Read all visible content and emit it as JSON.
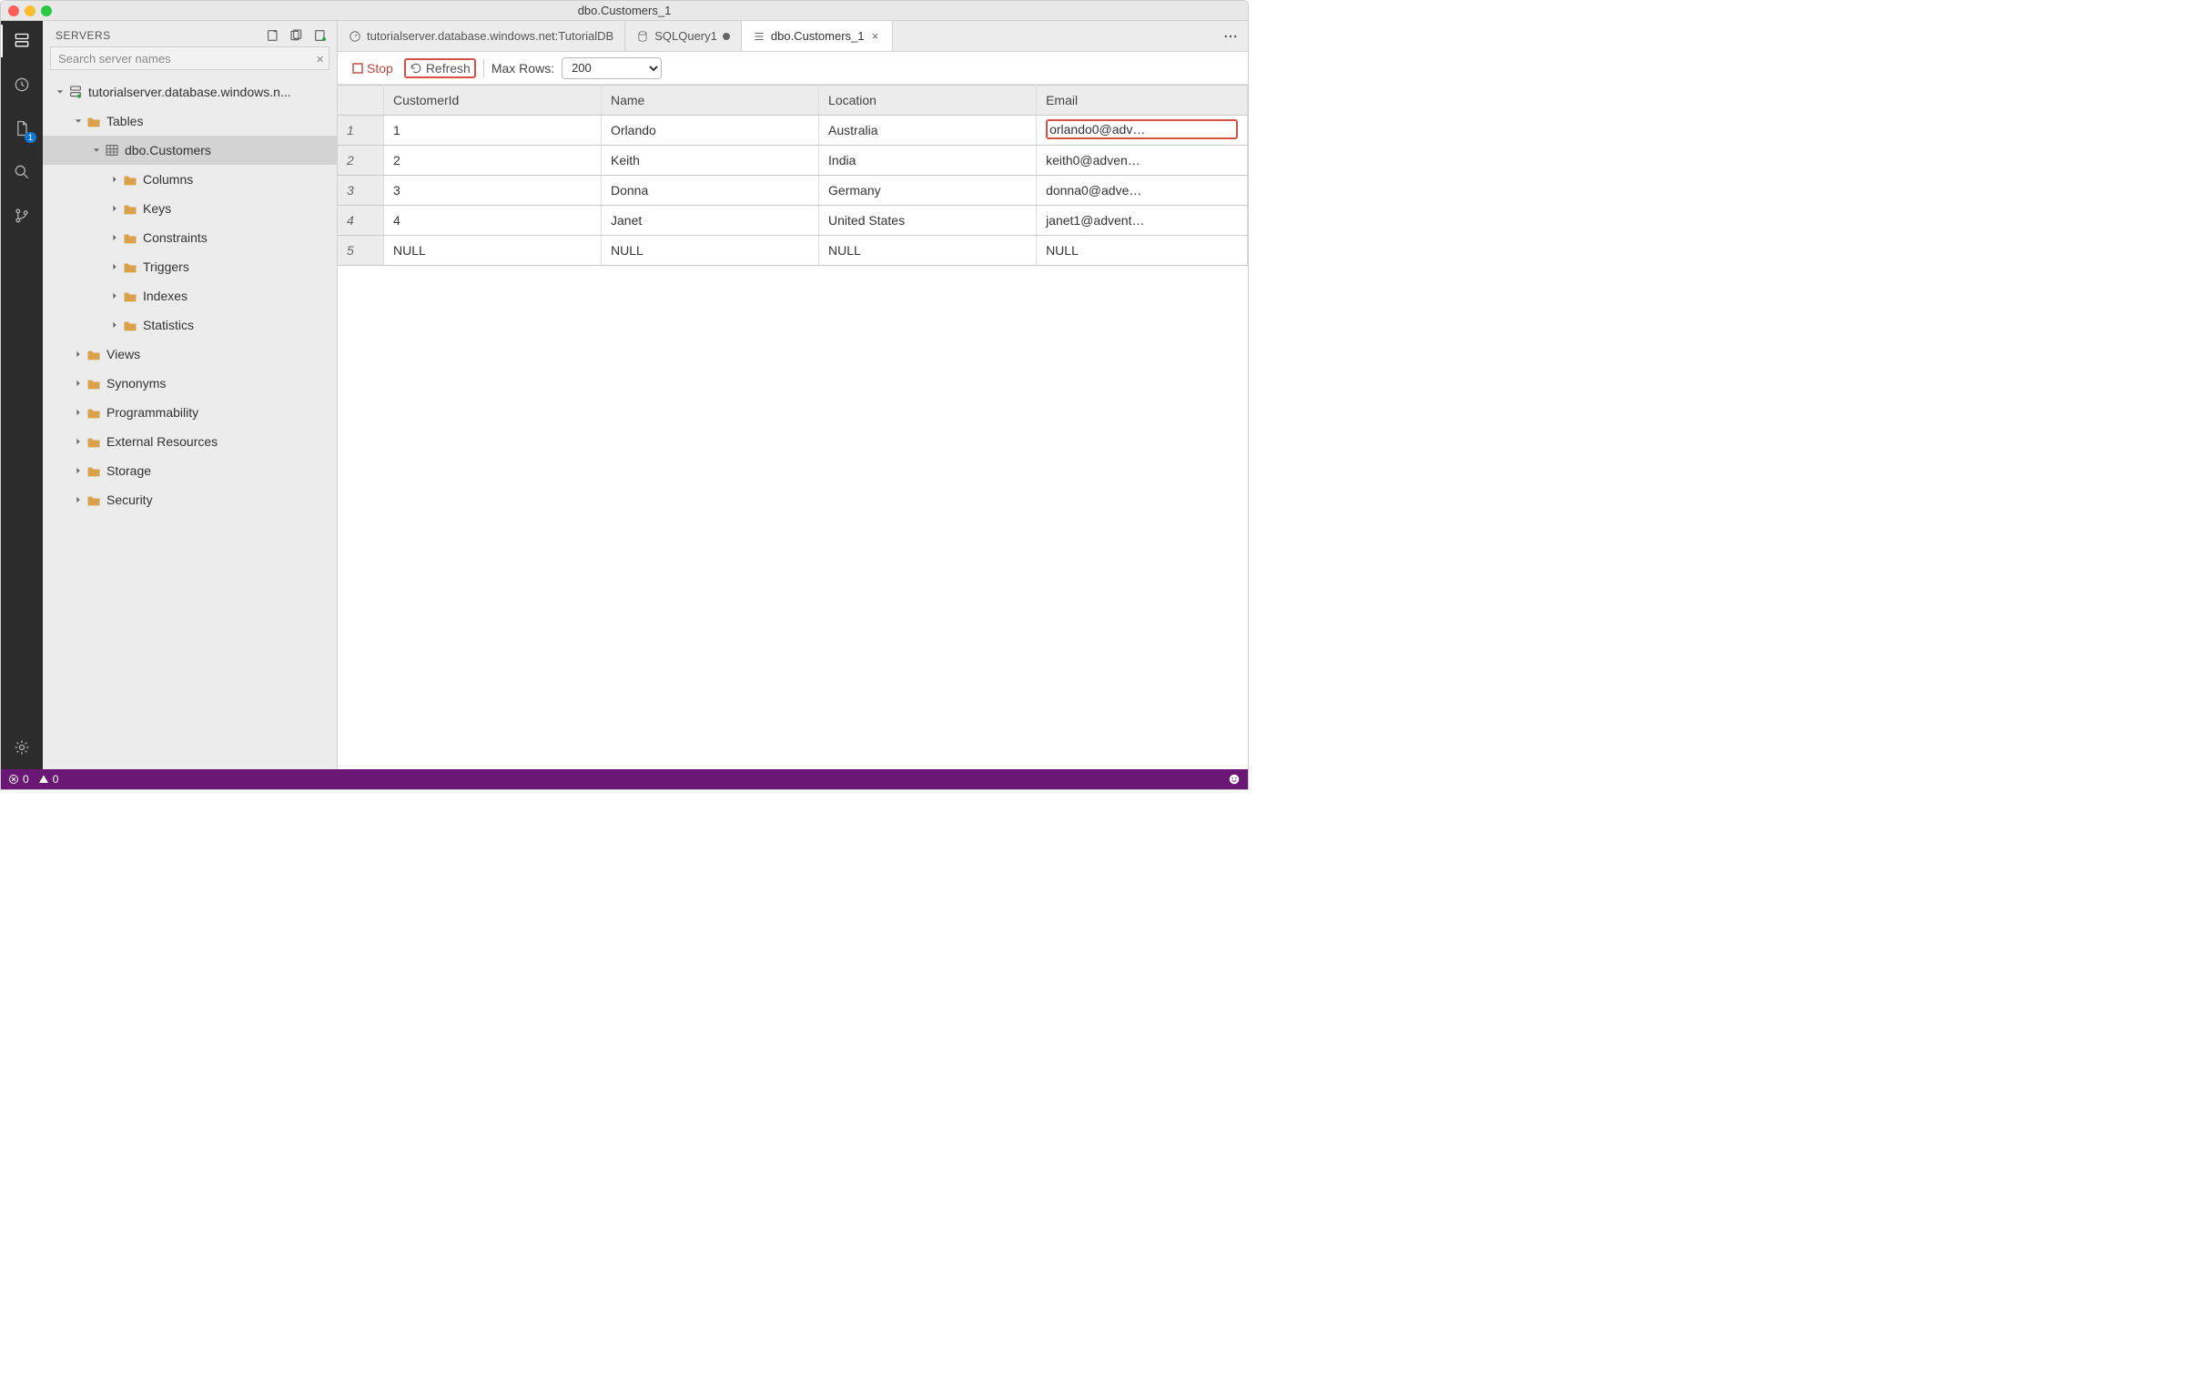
{
  "window": {
    "title": "dbo.Customers_1"
  },
  "activitybar": {
    "items": [
      {
        "name": "servers",
        "badge": ""
      },
      {
        "name": "task-history",
        "badge": ""
      },
      {
        "name": "explorer",
        "badge": "1"
      },
      {
        "name": "search",
        "badge": ""
      },
      {
        "name": "source-control",
        "badge": ""
      }
    ],
    "settings": "settings"
  },
  "sidebar": {
    "title": "SERVERS",
    "search_placeholder": "Search server names",
    "tree": [
      {
        "depth": 0,
        "expand": "down",
        "icon": "server",
        "label": "tutorialserver.database.windows.n...",
        "sel": false
      },
      {
        "depth": 1,
        "expand": "down",
        "icon": "folder",
        "label": "Tables",
        "sel": false
      },
      {
        "depth": 2,
        "expand": "down",
        "icon": "table",
        "label": "dbo.Customers",
        "sel": true
      },
      {
        "depth": 3,
        "expand": "right",
        "icon": "folder",
        "label": "Columns",
        "sel": false
      },
      {
        "depth": 3,
        "expand": "right",
        "icon": "folder",
        "label": "Keys",
        "sel": false
      },
      {
        "depth": 3,
        "expand": "right",
        "icon": "folder",
        "label": "Constraints",
        "sel": false
      },
      {
        "depth": 3,
        "expand": "right",
        "icon": "folder",
        "label": "Triggers",
        "sel": false
      },
      {
        "depth": 3,
        "expand": "right",
        "icon": "folder",
        "label": "Indexes",
        "sel": false
      },
      {
        "depth": 3,
        "expand": "right",
        "icon": "folder",
        "label": "Statistics",
        "sel": false
      },
      {
        "depth": 1,
        "expand": "right",
        "icon": "folder",
        "label": "Views",
        "sel": false
      },
      {
        "depth": 1,
        "expand": "right",
        "icon": "folder",
        "label": "Synonyms",
        "sel": false
      },
      {
        "depth": 1,
        "expand": "right",
        "icon": "folder",
        "label": "Programmability",
        "sel": false
      },
      {
        "depth": 1,
        "expand": "right",
        "icon": "folder",
        "label": "External Resources",
        "sel": false
      },
      {
        "depth": 1,
        "expand": "right",
        "icon": "folder",
        "label": "Storage",
        "sel": false
      },
      {
        "depth": 1,
        "expand": "right",
        "icon": "folder",
        "label": "Security",
        "sel": false
      }
    ]
  },
  "tabs": [
    {
      "icon": "dashboard",
      "label": "tutorialserver.database.windows.net:TutorialDB",
      "active": false,
      "close": "none"
    },
    {
      "icon": "db",
      "label": "SQLQuery1",
      "active": false,
      "close": "dirty"
    },
    {
      "icon": "result",
      "label": "dbo.Customers_1",
      "active": true,
      "close": "close"
    }
  ],
  "toolbar": {
    "stop_label": "Stop",
    "refresh_label": "Refresh",
    "maxrows_label": "Max Rows:",
    "maxrows_value": "200"
  },
  "grid": {
    "columns": [
      "CustomerId",
      "Name",
      "Location",
      "Email"
    ],
    "rows": [
      {
        "n": "1",
        "c": [
          "1",
          "Orlando",
          "Australia",
          "orlando0@adv…"
        ],
        "hl": 3
      },
      {
        "n": "2",
        "c": [
          "2",
          "Keith",
          "India",
          "keith0@adven…"
        ],
        "hl": -1
      },
      {
        "n": "3",
        "c": [
          "3",
          "Donna",
          "Germany",
          "donna0@adve…"
        ],
        "hl": -1
      },
      {
        "n": "4",
        "c": [
          "4",
          "Janet",
          "United States",
          "janet1@advent…"
        ],
        "hl": -1
      },
      {
        "n": "5",
        "c": [
          "NULL",
          "NULL",
          "NULL",
          "NULL"
        ],
        "hl": -1
      }
    ]
  },
  "statusbar": {
    "errors": "0",
    "warnings": "0"
  }
}
